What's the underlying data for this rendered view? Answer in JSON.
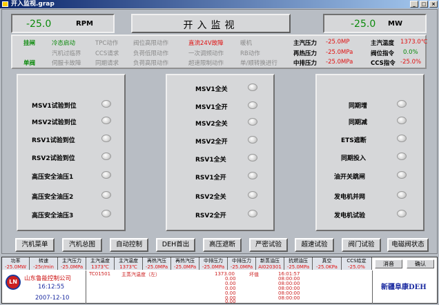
{
  "window": {
    "title": "开入监视.grap"
  },
  "rpm": {
    "value": "-25.0",
    "unit": "RPM"
  },
  "page_title": "开入监视",
  "mw": {
    "value": "-25.0",
    "unit": "MW"
  },
  "status": {
    "r1": [
      "挂闸",
      "冷态启动",
      "TPC动作",
      "阀位高限动作",
      "直流24V故障",
      "暖机"
    ],
    "r2": [
      "",
      "汽机过临界",
      "CCS请求",
      "负荷低限动作",
      "一次调频动作",
      "RB动作"
    ],
    "r3": [
      "单阀",
      "伺服卡故障",
      "同期请求",
      "负荷高限动作",
      "超速限制动作",
      "单/顺转换进行"
    ]
  },
  "params": [
    {
      "label": "主汽压力",
      "value": "-25.0MP"
    },
    {
      "label": "主汽温度",
      "value": "1373.0℃"
    },
    {
      "label": "再热压力",
      "value": "-25.0MPa"
    },
    {
      "label": "阀位指令",
      "value": "0.0%"
    },
    {
      "label": "中排压力",
      "value": "-25.0MPa"
    },
    {
      "label": "CCS指令",
      "value": "-25.0%"
    }
  ],
  "left_lamps": [
    "MSV1试验到位",
    "MSV2试验到位",
    "RSV1试验到位",
    "RSV2试验到位",
    "高压安全油压1",
    "高压安全油压2",
    "高压安全油压3"
  ],
  "mid_lamps": [
    "MSV1全关",
    "MSV1全开",
    "MSV2全关",
    "MSV2全开",
    "RSV1全关",
    "RSV1全开",
    "RSV2全关",
    "RSV2全开"
  ],
  "right_lamps": [
    "同期增",
    "同期减",
    "ETS遮断",
    "同期投入",
    "油开关跳闸",
    "发电机并网",
    "发电机试验"
  ],
  "buttons": [
    "汽机菜单",
    "汽机总图",
    "自动控制",
    "DEH首出",
    "高压遮断",
    "严密试验",
    "超速试验",
    "阀门试验",
    "电磁阀状态"
  ],
  "bottom": {
    "headers": [
      {
        "label": "功率",
        "value": "-25.0MW"
      },
      {
        "label": "转速",
        "value": "-25r/min"
      },
      {
        "label": "主汽压力",
        "value": "-25.0MPa"
      },
      {
        "label": "主汽温度",
        "value": "1373℃"
      },
      {
        "label": "主汽温度",
        "value": "1373℃"
      },
      {
        "label": "再热汽压",
        "value": "-25.0MPa"
      },
      {
        "label": "再热汽压",
        "value": "-25.0MPa"
      },
      {
        "label": "中排压力",
        "value": "-25.0MPa"
      },
      {
        "label": "中排压力",
        "value": "-25.0MPa"
      },
      {
        "label": "新蒸油压",
        "value": "AI020301"
      },
      {
        "label": "抗燃油压",
        "value": "-25.0MPa"
      },
      {
        "label": "真空",
        "value": "-25.0KPa"
      },
      {
        "label": "CCS给定",
        "value": "-25.0%"
      }
    ],
    "mute_label": "消音",
    "confirm_label": "确认",
    "company": "山东鲁能控制公司",
    "time": "16:12:55",
    "date": "2007-12-10",
    "logo_text": "LN",
    "alarm": {
      "code": "TC01501",
      "desc": "主蒸汽温度（左）",
      "value": "1373.00",
      "status": "坏值",
      "zeros": [
        "0.00",
        "0.00",
        "0.00",
        "0.00",
        "0.00",
        "0.00"
      ],
      "times": [
        "16:01:57",
        "08:00:00",
        "08:00:00",
        "08:00:00",
        "08:00:00",
        "08:00:00"
      ]
    },
    "brand": "新疆阜康DEH"
  }
}
